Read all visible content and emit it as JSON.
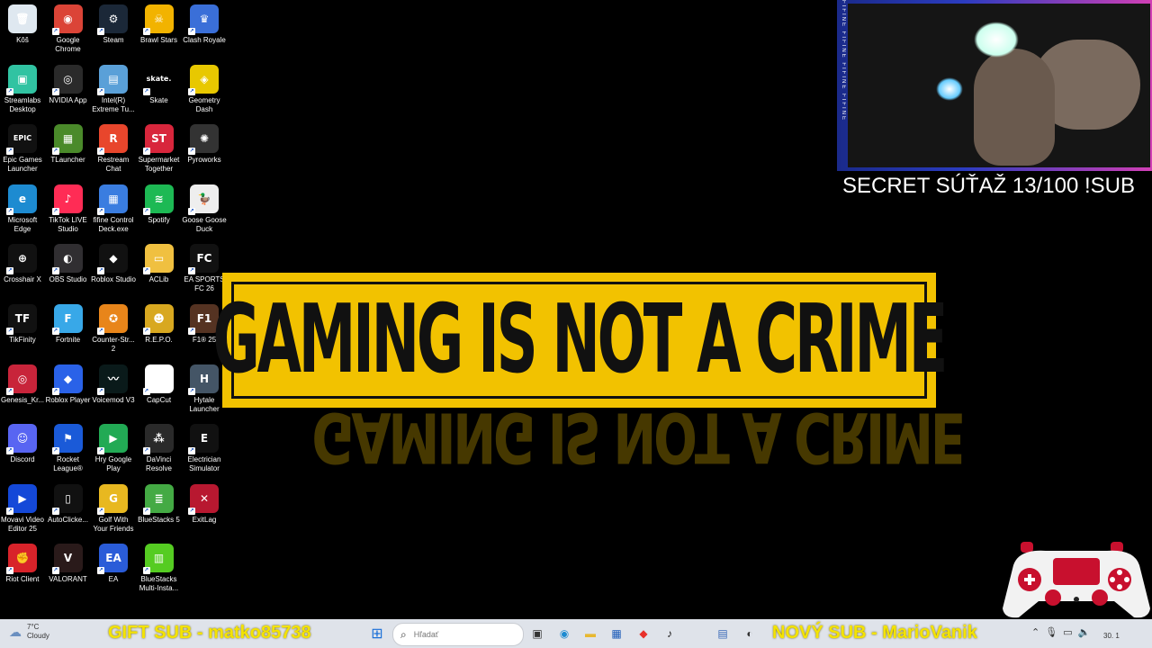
{
  "desktop": {
    "icons": [
      {
        "label": "Kôš",
        "glyph": "🗑",
        "color": "#dfe8f0"
      },
      {
        "label": "Google Chrome",
        "glyph": "◉",
        "color": "#db4437"
      },
      {
        "label": "Steam",
        "glyph": "⚙",
        "color": "#1b2838"
      },
      {
        "label": "Brawl Stars",
        "glyph": "☠",
        "color": "#f2b300"
      },
      {
        "label": "Clash Royale",
        "glyph": "♛",
        "color": "#3a6fd8"
      },
      {
        "label": "Streamlabs Desktop",
        "glyph": "▣",
        "color": "#31c3a2"
      },
      {
        "label": "NVIDIA App",
        "glyph": "◎",
        "color": "#2a2a2a"
      },
      {
        "label": "Intel(R) Extreme Tu...",
        "glyph": "▤",
        "color": "#5aa0d8"
      },
      {
        "label": "Skate",
        "glyph": "skate.",
        "color": "#000000"
      },
      {
        "label": "Geometry Dash",
        "glyph": "◈",
        "color": "#e8c800"
      },
      {
        "label": "Epic Games Launcher",
        "glyph": "EPIC",
        "color": "#111111"
      },
      {
        "label": "TLauncher",
        "glyph": "▦",
        "color": "#4a8a2a"
      },
      {
        "label": "Restream Chat",
        "glyph": "R",
        "color": "#e8462c"
      },
      {
        "label": "Supermarket Together",
        "glyph": "ST",
        "color": "#d8263c"
      },
      {
        "label": "Pyroworks",
        "glyph": "✺",
        "color": "#333333"
      },
      {
        "label": "Microsoft Edge",
        "glyph": "e",
        "color": "#1d8bd1"
      },
      {
        "label": "TikTok LIVE Studio",
        "glyph": "♪",
        "color": "#ff2c55"
      },
      {
        "label": "fifine Control Deck.exe",
        "glyph": "▦",
        "color": "#3a7de0"
      },
      {
        "label": "Spotify",
        "glyph": "≋",
        "color": "#1db954"
      },
      {
        "label": "Goose Goose Duck",
        "glyph": "🦆",
        "color": "#eeeeee"
      },
      {
        "label": "Crosshair X",
        "glyph": "⊕",
        "color": "#111111"
      },
      {
        "label": "OBS Studio",
        "glyph": "◐",
        "color": "#302e31"
      },
      {
        "label": "Roblox Studio",
        "glyph": "◆",
        "color": "#111111"
      },
      {
        "label": "ACLib",
        "glyph": "▭",
        "color": "#f0c040"
      },
      {
        "label": "EA SPORTS FC 26",
        "glyph": "FC",
        "color": "#111111"
      },
      {
        "label": "TikFinity",
        "glyph": "TF",
        "color": "#111111"
      },
      {
        "label": "Fortnite",
        "glyph": "F",
        "color": "#38a8e8"
      },
      {
        "label": "Counter-Str... 2",
        "glyph": "✪",
        "color": "#e8851a"
      },
      {
        "label": "R.E.P.O.",
        "glyph": "☻",
        "color": "#d8a820"
      },
      {
        "label": "F1® 25",
        "glyph": "F1",
        "color": "#553322"
      },
      {
        "label": "Genesis_Kr...",
        "glyph": "◎",
        "color": "#c8243a"
      },
      {
        "label": "Roblox Player",
        "glyph": "◆",
        "color": "#2a62e8"
      },
      {
        "label": "Voicemod V3",
        "glyph": "〰",
        "color": "#0a1a1a"
      },
      {
        "label": "CapCut",
        "glyph": "✂",
        "color": "#ffffff"
      },
      {
        "label": "Hytale Launcher",
        "glyph": "H",
        "color": "#445566"
      },
      {
        "label": "Discord",
        "glyph": "☺",
        "color": "#5865f2"
      },
      {
        "label": "Rocket League®",
        "glyph": "⚑",
        "color": "#1a5ad8"
      },
      {
        "label": "Hry Google Play",
        "glyph": "▶",
        "color": "#22aa55"
      },
      {
        "label": "DaVinci Resolve",
        "glyph": "⁂",
        "color": "#2a2a2a"
      },
      {
        "label": "Electrician Simulator",
        "glyph": "E",
        "color": "#111111"
      },
      {
        "label": "Movavi Video Editor 25",
        "glyph": "▶",
        "color": "#1448d8"
      },
      {
        "label": "AutoClicke...",
        "glyph": "▯",
        "color": "#111111"
      },
      {
        "label": "Golf With Your Friends",
        "glyph": "G",
        "color": "#e8b820"
      },
      {
        "label": "BlueStacks 5",
        "glyph": "≣",
        "color": "#44aa44"
      },
      {
        "label": "ExitLag",
        "glyph": "✕",
        "color": "#b81830"
      },
      {
        "label": "Riot Client",
        "glyph": "✊",
        "color": "#d8232a"
      },
      {
        "label": "VALORANT",
        "glyph": "V",
        "color": "#2a1a1a"
      },
      {
        "label": "EA",
        "glyph": "EA",
        "color": "#2a5cd8"
      },
      {
        "label": "BlueStacks Multi-Insta...",
        "glyph": "▥",
        "color": "#55cc22"
      }
    ]
  },
  "wallpaper": {
    "banner_text": "GAMING IS NOT A CRIME"
  },
  "stream_overlay": {
    "strip_text": "FIFINE FIFINE FIFINE FIFINE",
    "secret_text": "SECRET SÚŤAŽ  13/100 !SUB",
    "gift_text": "GIFT SUB - matko85738",
    "novy_text": "NOVÝ SUB - MarioVanik"
  },
  "taskbar": {
    "weather_temp": "7°C",
    "weather_desc": "Cloudy",
    "search_placeholder": "Hľadať",
    "clock_date": "30. 1"
  }
}
